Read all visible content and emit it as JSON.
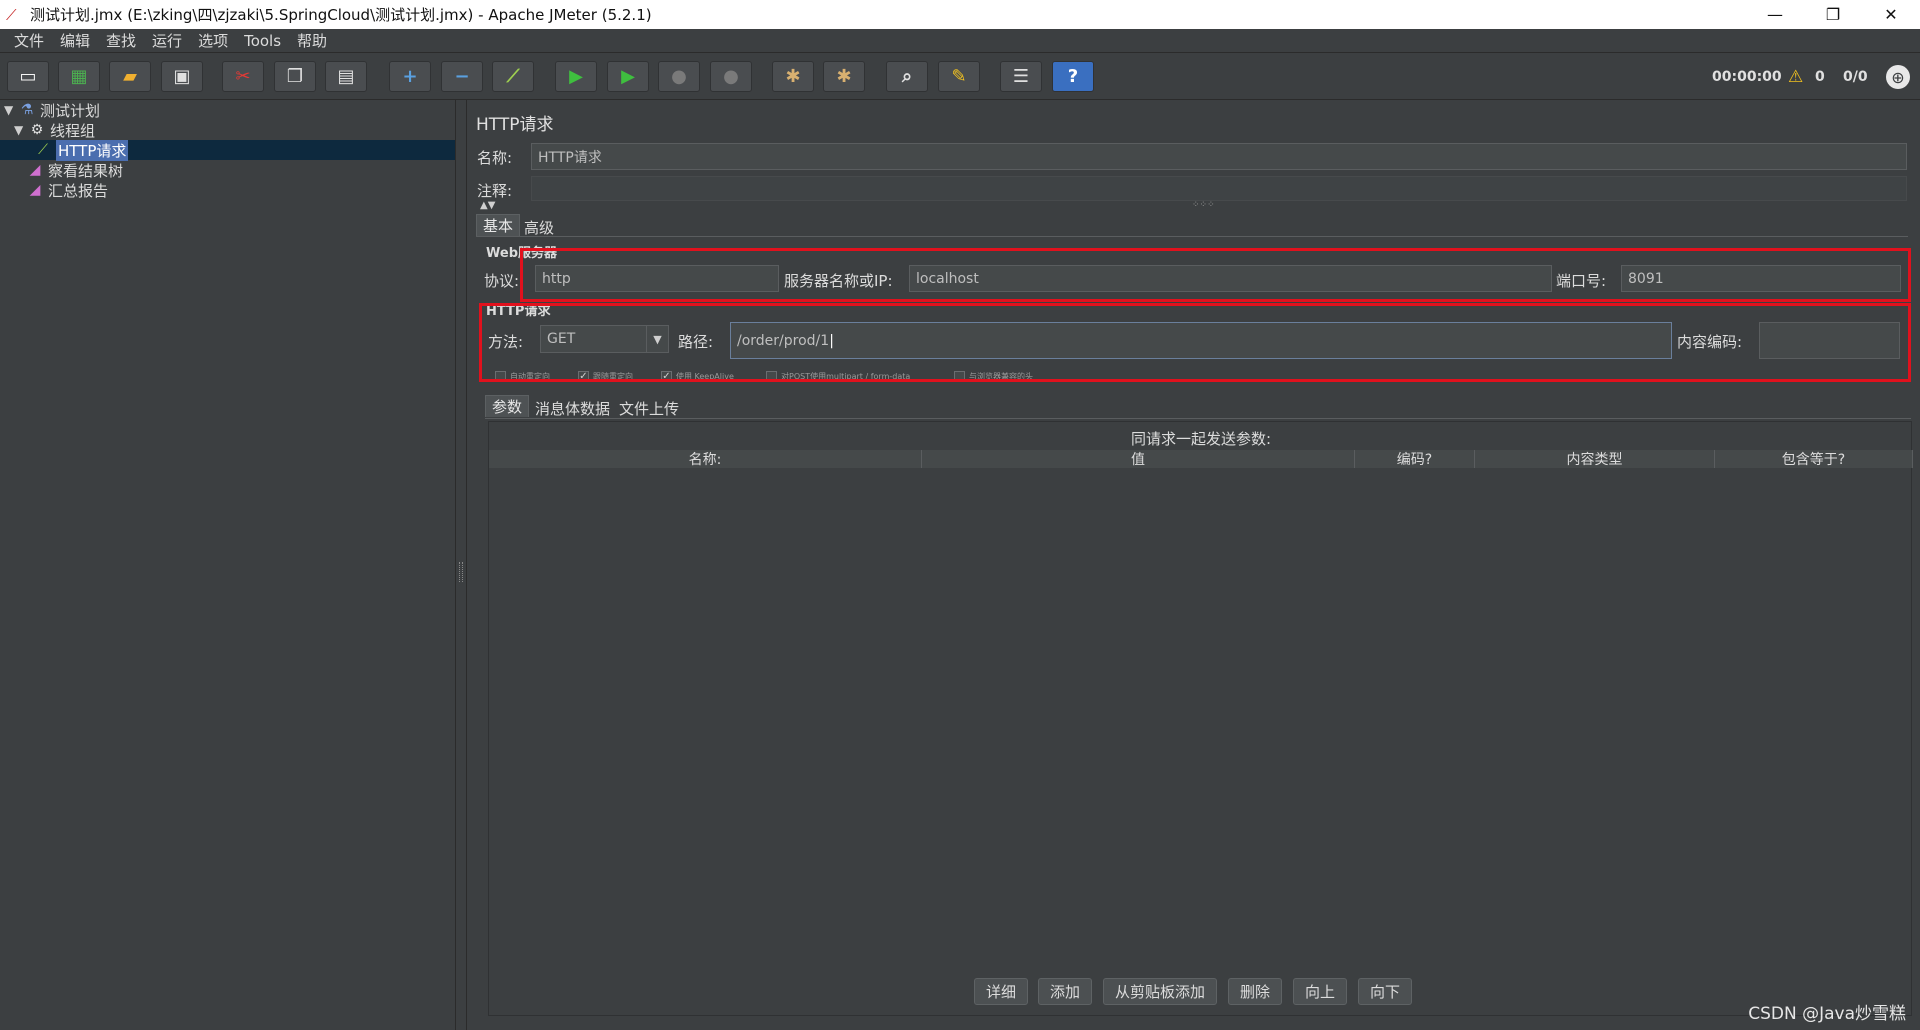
{
  "window": {
    "title": "测试计划.jmx (E:\\zking\\四\\zjzaki\\5.SpringCloud\\测试计划.jmx) - Apache JMeter (5.2.1)",
    "app_icon": "feather-icon",
    "minimize": "—",
    "restore": "❐",
    "close": "✕"
  },
  "menu": [
    "文件",
    "编辑",
    "查找",
    "运行",
    "选项",
    "Tools",
    "帮助"
  ],
  "toolbar": {
    "buttons": [
      {
        "name": "new-icon",
        "glyph": "▭",
        "color": "#f5f5f5"
      },
      {
        "name": "templates-icon",
        "glyph": "▦",
        "color": "#4caf50"
      },
      {
        "name": "open-icon",
        "glyph": "▰",
        "color": "#f0b030"
      },
      {
        "name": "save-icon",
        "glyph": "▣",
        "color": "#e0e0e0"
      },
      {
        "name": "cut-icon",
        "glyph": "✂",
        "color": "#e53935"
      },
      {
        "name": "copy-icon",
        "glyph": "❐",
        "color": "#e0e0e0"
      },
      {
        "name": "paste-icon",
        "glyph": "▤",
        "color": "#e0e0e0"
      },
      {
        "name": "expand-icon",
        "glyph": "+",
        "color": "#5aa0e0"
      },
      {
        "name": "collapse-icon",
        "glyph": "−",
        "color": "#5aa0e0"
      },
      {
        "name": "toggle-icon",
        "glyph": "⟋",
        "color": "#9fd050"
      },
      {
        "name": "start-icon",
        "glyph": "▶",
        "color": "#3fbf3f"
      },
      {
        "name": "start-no-pause-icon",
        "glyph": "▶",
        "color": "#3fbf3f"
      },
      {
        "name": "stop-icon",
        "glyph": "●",
        "color": "#7a7a7a"
      },
      {
        "name": "shutdown-icon",
        "glyph": "●",
        "color": "#7a7a7a"
      },
      {
        "name": "clear-icon",
        "glyph": "✱",
        "color": "#d8b070"
      },
      {
        "name": "clear-all-icon",
        "glyph": "✱",
        "color": "#d8b070"
      },
      {
        "name": "search-icon",
        "glyph": "⌕",
        "color": "#e0e0e0"
      },
      {
        "name": "reset-search-icon",
        "glyph": "✎",
        "color": "#f0c020"
      },
      {
        "name": "function-helper-icon",
        "glyph": "☰",
        "color": "#e0e0e0"
      },
      {
        "name": "help-icon",
        "glyph": "?",
        "color": "#ffffff"
      }
    ],
    "timer": "00:00:00",
    "warning_icon": "⚠",
    "warning_count": "0",
    "threads": "0/0",
    "globe_icon": "⊕"
  },
  "tree": {
    "items": [
      {
        "label": "测试计划",
        "icon": "test-plan-icon",
        "glyph": "⚗"
      },
      {
        "label": "线程组",
        "icon": "thread-group-icon",
        "glyph": "⚙"
      },
      {
        "label": "HTTP请求",
        "icon": "sampler-icon",
        "glyph": "⟋"
      },
      {
        "label": "察看结果树",
        "icon": "listener-icon",
        "glyph": "◢"
      },
      {
        "label": "汇总报告",
        "icon": "listener-icon",
        "glyph": "◢"
      }
    ],
    "twisty_open": "▼"
  },
  "panel": {
    "title": "HTTP请求",
    "name_label": "名称:",
    "name_value": "HTTP请求",
    "comment_label": "注释:",
    "tabs": [
      "基本",
      "高级"
    ],
    "web_server_group": "Web服务器",
    "protocol_label": "协议:",
    "protocol_value": "http",
    "server_label": "服务器名称或IP:",
    "server_value": "localhost",
    "port_label": "端口号:",
    "port_value": "8091",
    "http_request_group": "HTTP请求",
    "method_label": "方法:",
    "method_value": "GET",
    "path_label": "路径:",
    "path_value": "/order/prod/1",
    "encoding_label": "内容编码:",
    "encoding_value": "",
    "checkboxes": [
      {
        "label": "自动重定向",
        "checked": false
      },
      {
        "label": "跟随重定向",
        "checked": true
      },
      {
        "label": "使用 KeepAlive",
        "checked": true
      },
      {
        "label": "对POST使用multipart / form-data",
        "checked": false
      },
      {
        "label": "与浏览器兼容的头",
        "checked": false
      }
    ],
    "sub_tabs": [
      "参数",
      "消息体数据",
      "文件上传"
    ],
    "params_caption": "同请求一起发送参数:",
    "columns": [
      "名称:",
      "值",
      "编码?",
      "内容类型",
      "包含等于?"
    ],
    "buttons": [
      "详细",
      "添加",
      "从剪贴板添加",
      "删除",
      "向上",
      "向下"
    ]
  },
  "watermark": "CSDN @Java炒雪糕"
}
